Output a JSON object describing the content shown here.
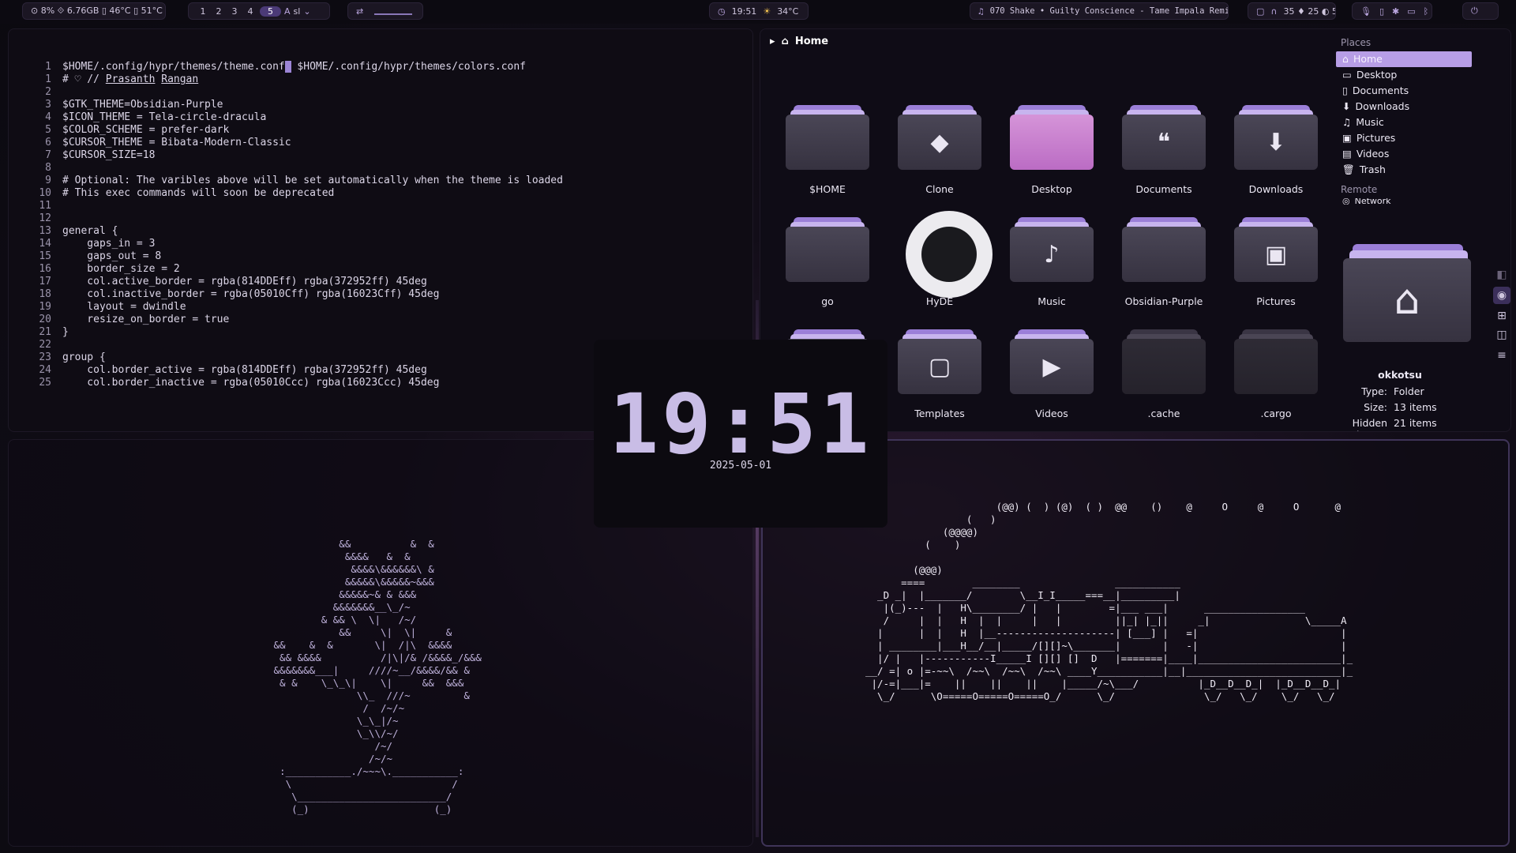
{
  "topbar": {
    "sysinfo": "⊙ 8%  ⟐ 6.76GB  ▯ 46°C  ▯ 51°C",
    "workspaces": [
      "1",
      "2",
      "3",
      "4",
      "5"
    ],
    "active_workspace": "5",
    "kb_layout": "sl",
    "clock_mini": "19:51",
    "weather": "34°C",
    "media": "070 Shake • Guilty Conscience - Tame Impala Remix",
    "tray_stats": "35  ♦ 25  ◐ 53"
  },
  "editor": {
    "lines": [
      {
        "n": "1",
        "t": "$HOME/.config/hypr/themes/theme.conf",
        "t2": " $HOME/.config/hypr/themes/colors.conf"
      },
      {
        "n": "1",
        "t": "# ♡ // ",
        "author1": "Prasanth",
        "author2": "Rangan"
      },
      {
        "n": "2",
        "t": ""
      },
      {
        "n": "3",
        "t": "$GTK_THEME=Obsidian-Purple"
      },
      {
        "n": "4",
        "t": "$ICON_THEME = Tela-circle-dracula"
      },
      {
        "n": "5",
        "t": "$COLOR_SCHEME = prefer-dark"
      },
      {
        "n": "6",
        "t": "$CURSOR_THEME = Bibata-Modern-Classic"
      },
      {
        "n": "7",
        "t": "$CURSOR_SIZE=18"
      },
      {
        "n": "8",
        "t": ""
      },
      {
        "n": "9",
        "t": "# Optional: The varibles above will be set automatically when the theme is loaded"
      },
      {
        "n": "10",
        "t": "# This exec commands will soon be deprecated"
      },
      {
        "n": "11",
        "t": ""
      },
      {
        "n": "12",
        "t": ""
      },
      {
        "n": "13",
        "t": "general {"
      },
      {
        "n": "14",
        "t": "    gaps_in = 3"
      },
      {
        "n": "15",
        "t": "    gaps_out = 8"
      },
      {
        "n": "16",
        "t": "    border_size = 2"
      },
      {
        "n": "17",
        "t": "    col.active_border = rgba(814DDEff) rgba(372952ff) 45deg"
      },
      {
        "n": "18",
        "t": "    col.inactive_border = rgba(05010Cff) rgba(16023Cff) 45deg"
      },
      {
        "n": "19",
        "t": "    layout = dwindle"
      },
      {
        "n": "20",
        "t": "    resize_on_border = true"
      },
      {
        "n": "21",
        "t": "}"
      },
      {
        "n": "22",
        "t": ""
      },
      {
        "n": "23",
        "t": "group {"
      },
      {
        "n": "24",
        "t": "    col.border_active = rgba(814DDEff) rgba(372952ff) 45deg"
      },
      {
        "n": "25",
        "t": "    col.border_inactive = rgba(05010Ccc) rgba(16023Ccc) 45deg"
      }
    ]
  },
  "clock": {
    "time": "19:51",
    "date": "2025-05-01"
  },
  "files": {
    "breadcrumb": "Home",
    "items": [
      {
        "name": "$HOME",
        "icon": "folder",
        "style": ""
      },
      {
        "name": "Clone",
        "icon": "git-icon",
        "glyph": "◆",
        "style": ""
      },
      {
        "name": "Desktop",
        "icon": "desktop-folder",
        "style": "pink"
      },
      {
        "name": "Documents",
        "icon": "document-icon",
        "glyph": "❝",
        "style": ""
      },
      {
        "name": "Downloads",
        "icon": "download-icon",
        "glyph": "⬇",
        "style": ""
      },
      {
        "name": "go",
        "icon": "folder",
        "style": ""
      },
      {
        "name": "HyDE",
        "icon": "github-icon",
        "style": "github"
      },
      {
        "name": "Music",
        "icon": "music-icon",
        "glyph": "♪",
        "style": ""
      },
      {
        "name": "Obsidian-Purple",
        "icon": "folder",
        "style": ""
      },
      {
        "name": "Pictures",
        "icon": "picture-icon",
        "glyph": "▣",
        "style": ""
      },
      {
        "name": "",
        "icon": "folder",
        "glyph": "●",
        "style": ""
      },
      {
        "name": "Templates",
        "icon": "template-icon",
        "glyph": "▢",
        "style": ""
      },
      {
        "name": "Videos",
        "icon": "video-icon",
        "glyph": "▶",
        "style": ""
      },
      {
        "name": ".cache",
        "icon": "folder",
        "style": "dim"
      },
      {
        "name": ".cargo",
        "icon": "folder",
        "style": "dim"
      }
    ],
    "places_header": "Places",
    "places": [
      {
        "label": "Home",
        "glyph": "⌂"
      },
      {
        "label": "Desktop",
        "glyph": "▭"
      },
      {
        "label": "Documents",
        "glyph": "▯"
      },
      {
        "label": "Downloads",
        "glyph": "⬇"
      },
      {
        "label": "Music",
        "glyph": "♫"
      },
      {
        "label": "Pictures",
        "glyph": "▣"
      },
      {
        "label": "Videos",
        "glyph": "▤"
      },
      {
        "label": "Trash",
        "glyph": "🗑"
      }
    ],
    "remote_header": "Remote",
    "remote_item": "Network",
    "info": {
      "name": "okkotsu",
      "type_label": "Type:",
      "type_value": "Folder",
      "size_label": "Size:",
      "size_value": "13 items",
      "hidden_label": "Hidden items:",
      "hidden_value": "21 items"
    }
  },
  "ascii": {
    "bonsai": "            &&          &  &\n             &&&&   &  &\n              &&&&\\&&&&&&\\ &\n             &&&&&\\&&&&&~&&&\n            &&&&&~& & &&&\n           &&&&&&&__\\_/~\n         & && \\  \\|   /~/\n            &&     \\|  \\|     &\n &&    &  &       \\|  /|\\  &&&&\n  && &&&&          /|\\|/& /&&&&_/&&&\n &&&&&&&___|     ////~__/&&&&/&& &\n  & &    \\_\\_\\|    \\|     &&  &&&\n               \\\\_  ///~         &\n                /  /~/~\n               \\_\\_|/~\n               \\_\\\\/~/\n                  /~/\n                 /~/~\n  :___________./~~~\\.___________:\n   \\                           /\n    \\_________________________/\n    (_)                     (_)",
    "train": "                      (@@) (  ) (@)  ( )  @@    ()    @     O     @     O      @\n                 (   )\n             (@@@@)\n          (    )\n\n        (@@@)\n      ====        ________                ___________\n  _D _|  |_______/        \\__I_I_____===__|_________|\n   |(_)---  |   H\\________/ |   |        =|___ ___|      _________________\n   /     |  |   H  |  |     |   |         ||_| |_||     _|                \\_____A\n  |      |  |   H  |__--------------------| [___] |   =|                        |\n  | ________|___H__/__|_____/[][]~\\_______|       |   -|                        |\n  |/ |   |-----------I_____I [][] []  D   |=======|____|________________________|_\n__/ =| o |=-~~\\  /~~\\  /~~\\  /~~\\ ____Y___________|__|__________________________|_\n |/-=|___|=    ||    ||    ||    |_____/~\\___/          |_D__D__D_|  |_D__D__D_|\n  \\_/      \\O=====O=====O=====O_/      \\_/               \\_/   \\_/    \\_/   \\_/"
  }
}
